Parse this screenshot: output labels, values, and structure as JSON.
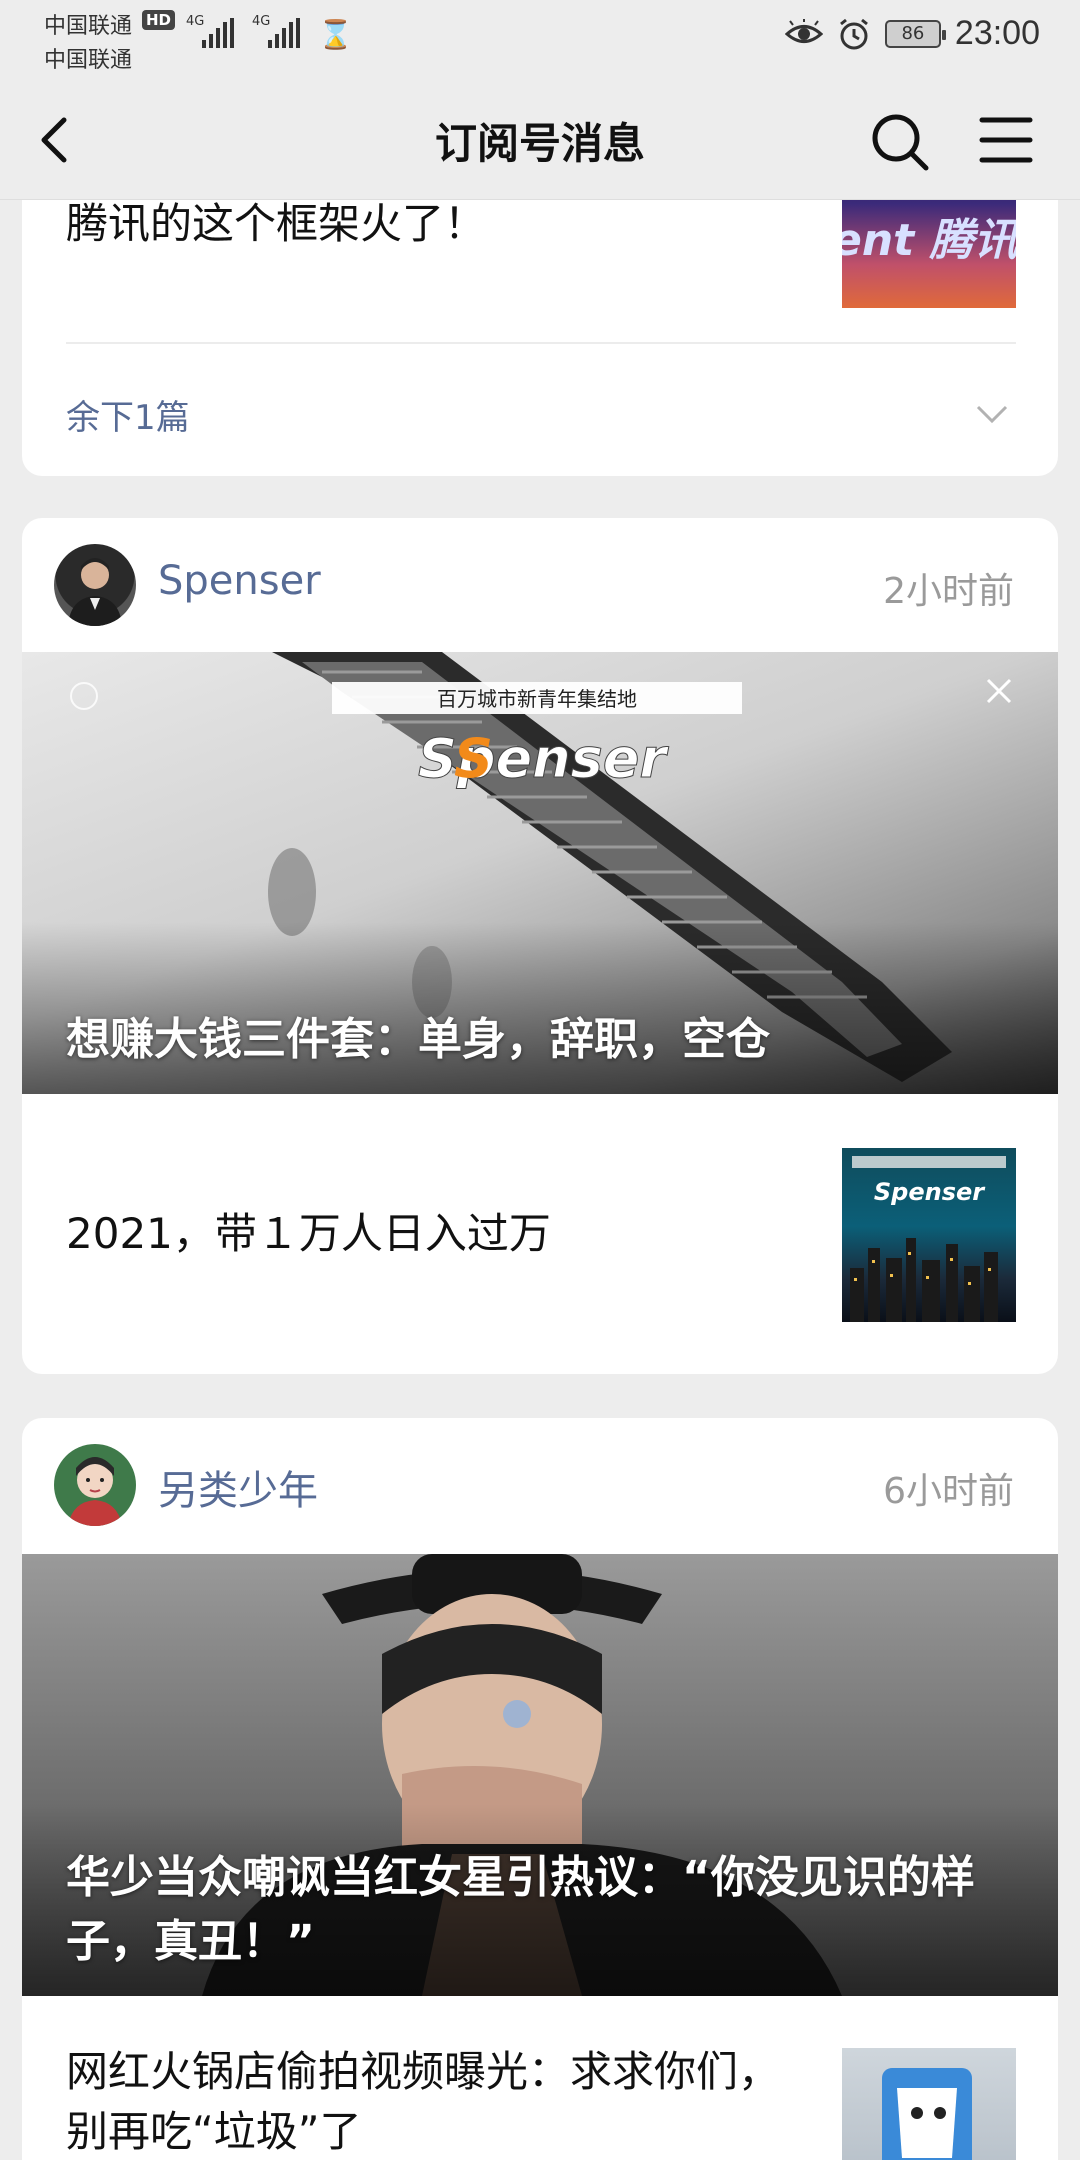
{
  "status_bar": {
    "carrier1": "中国联通",
    "carrier2": "中国联通",
    "hd": "HD",
    "net1": "4G",
    "net2": "4G",
    "battery": "86",
    "time": "23:00"
  },
  "nav": {
    "title": "订阅号消息"
  },
  "card1": {
    "title": "腾讯的这个框架火了！",
    "thumb_text": "ent 腾讯",
    "more": "余下1篇"
  },
  "card2": {
    "author": "Spenser",
    "time": "2小时前",
    "cover_banner": "百万城市新青年集结地",
    "cover_logo": "Spenser",
    "cover_title": "想赚大钱三件套：单身，辞职，空仓",
    "item_title": "2021，带１万人日入过万",
    "thumb_logo": "Spenser"
  },
  "card3": {
    "author": "另类少年",
    "time": "6小时前",
    "cover_title": "华少当众嘲讽当红女星引热议：“你没见识的样子，真丑！”",
    "item_title": "网红火锅店偷拍视频曝光：求求你们，别再吃“垃圾”了"
  }
}
